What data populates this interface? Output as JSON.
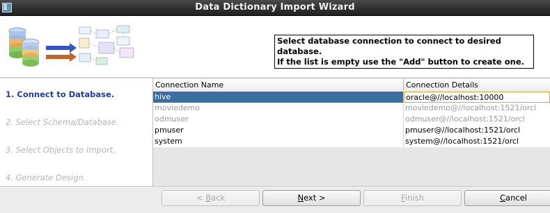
{
  "window": {
    "title": "Data Dictionary Import Wizard",
    "icon": "wizard-app-icon"
  },
  "header": {
    "instructions_line1": "Select database connection to connect to desired database.",
    "instructions_line2": "If the list is empty use the \"Add\" button to create one.",
    "illustration": "database-to-diagram-illustration"
  },
  "steps": [
    {
      "label": "1. Connect to Database.",
      "state": "active"
    },
    {
      "label": "2. Select Schema/Database.",
      "state": "disabled"
    },
    {
      "label": "3. Select Objects to Import.",
      "state": "disabled"
    },
    {
      "label": "4. Generate Design.",
      "state": "disabled"
    }
  ],
  "table": {
    "columns": [
      "Connection Name",
      "Connection Details"
    ],
    "rows": [
      {
        "name": "hive",
        "details": "oracle@//localhost:10000",
        "state": "selected"
      },
      {
        "name": "moviedemo",
        "details": "moviedemo@//localhost:1521/orcl",
        "state": "disabled"
      },
      {
        "name": "odmuser",
        "details": "odmuser@//localhost:1521/orcl",
        "state": "disabled"
      },
      {
        "name": "pmuser",
        "details": "pmuser@//localhost:1521/orcl",
        "state": "normal"
      },
      {
        "name": "system",
        "details": "system@//localhost:1521/orcl",
        "state": "normal"
      }
    ]
  },
  "buttons": {
    "back": {
      "prefix": "< ",
      "mnemonic": "B",
      "rest": "ack",
      "enabled": false
    },
    "next": {
      "mnemonic": "N",
      "rest": "ext >",
      "enabled": true
    },
    "finish": {
      "mnemonic": "F",
      "rest": "inish",
      "enabled": false
    },
    "cancel": {
      "mnemonic": "C",
      "rest": "ancel",
      "enabled": true
    }
  },
  "colors": {
    "selection": "#3c6e9f",
    "active_step": "#1f3f9f",
    "focus_border": "#e7a63b"
  }
}
